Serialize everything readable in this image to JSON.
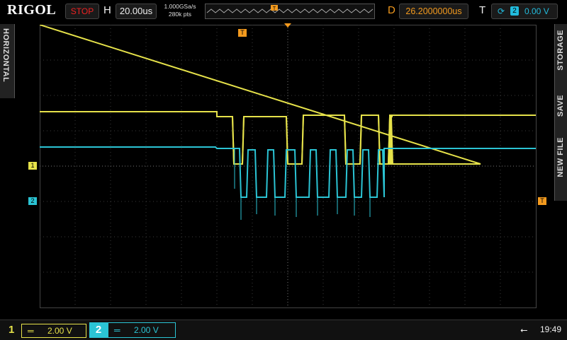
{
  "brand": "RIGOL",
  "run_state": "STOP",
  "horizontal": {
    "label": "H",
    "timebase": "20.00us"
  },
  "sample": {
    "rate": "1.000GSa/s",
    "points": "280k pts"
  },
  "delay": {
    "label": "D",
    "value": "26.2000000us"
  },
  "trigger": {
    "label": "T",
    "edge_icon": "rising-edge-icon",
    "source": "2",
    "level": "0.00 V"
  },
  "left_menu": "HORIZONTAL",
  "right_menu": {
    "storage": "STORAGE",
    "save": "SAVE",
    "new_file": "NEW FILE"
  },
  "channels": [
    {
      "id": "1",
      "scale": "2.00 V",
      "coupling_icon": "dc-coupling-icon",
      "color": "#e6e24a"
    },
    {
      "id": "2",
      "scale": "2.00 V",
      "coupling_icon": "dc-coupling-icon",
      "color": "#2bc4d4"
    }
  ],
  "markers": {
    "ch1": "1",
    "ch2": "2",
    "trigger": "T"
  },
  "status": {
    "usb_icon": "usb-icon",
    "time": "19:49"
  },
  "colors": {
    "ch1": "#e6e24a",
    "ch2": "#2bc4d4",
    "trigger": "#f39a1e",
    "stop": "#ee2222"
  }
}
